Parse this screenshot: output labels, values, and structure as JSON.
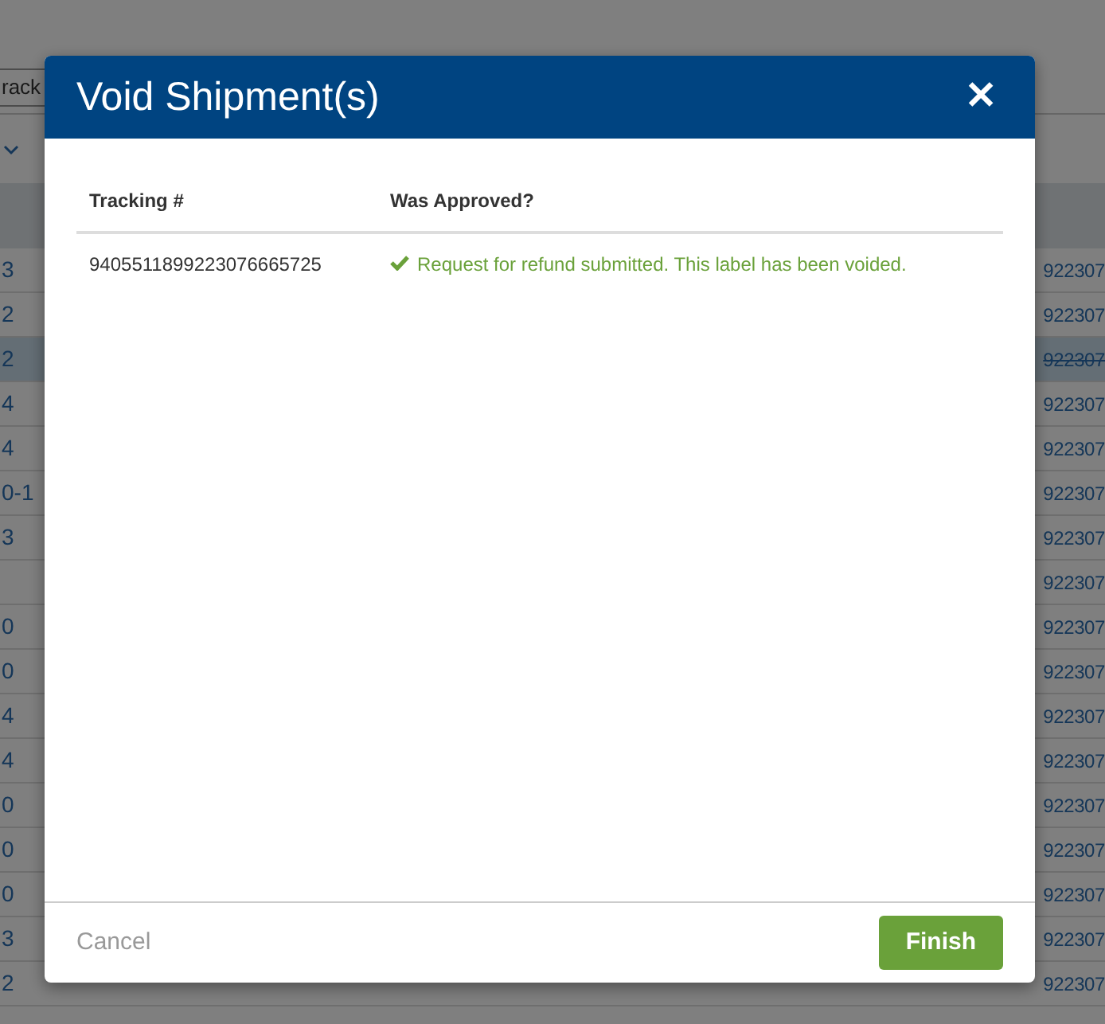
{
  "background": {
    "search_value": "rack",
    "rows": [
      {
        "column_1": "3",
        "column_2": "922307",
        "selected": false
      },
      {
        "column_1": "2",
        "column_2": "922307",
        "selected": false
      },
      {
        "column_1": "2",
        "column_2": "922307",
        "selected": true
      },
      {
        "column_1": "4",
        "column_2": "922307",
        "selected": false
      },
      {
        "column_1": "4",
        "column_2": "922307",
        "selected": false
      },
      {
        "column_1": "0-1",
        "column_2": "922307",
        "selected": false
      },
      {
        "column_1": "3",
        "column_2": "922307",
        "selected": false
      },
      {
        "column_1": "",
        "column_2": "922307",
        "selected": false
      },
      {
        "column_1": "0",
        "column_2": "922307",
        "selected": false
      },
      {
        "column_1": "0",
        "column_2": "922307",
        "selected": false
      },
      {
        "column_1": "4",
        "column_2": "922307",
        "selected": false
      },
      {
        "column_1": "4",
        "column_2": "922307",
        "selected": false
      },
      {
        "column_1": "0",
        "column_2": "922307",
        "selected": false
      },
      {
        "column_1": "0",
        "column_2": "922307",
        "selected": false
      },
      {
        "column_1": "0",
        "column_2": "922307",
        "selected": false
      },
      {
        "column_1": "3",
        "column_2": "922307",
        "selected": false
      },
      {
        "column_1": "2",
        "column_2": "922307",
        "selected": false
      }
    ]
  },
  "modal": {
    "title": "Void Shipment(s)",
    "close": "✕",
    "table": {
      "columns": [
        "Tracking #",
        "Was Approved?"
      ],
      "rows": [
        {
          "tracking": "9405511899223076665725",
          "approved": true,
          "message": "Request for refund submitted. This label has been voided."
        }
      ]
    },
    "buttons": [
      {
        "label": "Cancel",
        "kind": "link"
      },
      {
        "label": "Finish",
        "kind": "primary"
      }
    ]
  }
}
